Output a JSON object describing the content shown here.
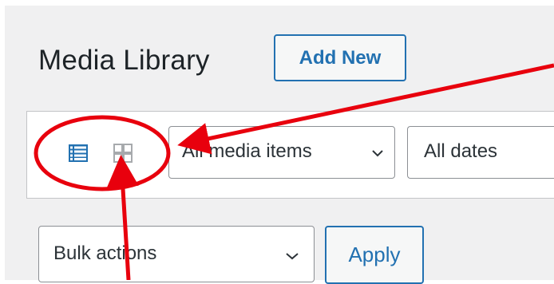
{
  "header": {
    "title": "Media Library",
    "add_new_label": "Add New"
  },
  "view_switch": {
    "list_icon": "list-view-icon",
    "grid_icon": "grid-view-icon",
    "active": "list"
  },
  "filters": {
    "media_type_selected": "All media items",
    "date_selected": "All dates"
  },
  "bulk": {
    "selected": "Bulk actions",
    "apply_label": "Apply"
  },
  "annotation": {
    "color": "#e8000d",
    "shapes": [
      "ellipse",
      "arrow",
      "arrow"
    ]
  },
  "colors": {
    "accent": "#2271b1",
    "background": "#f0f0f1",
    "annotation_red": "#e8000d"
  }
}
